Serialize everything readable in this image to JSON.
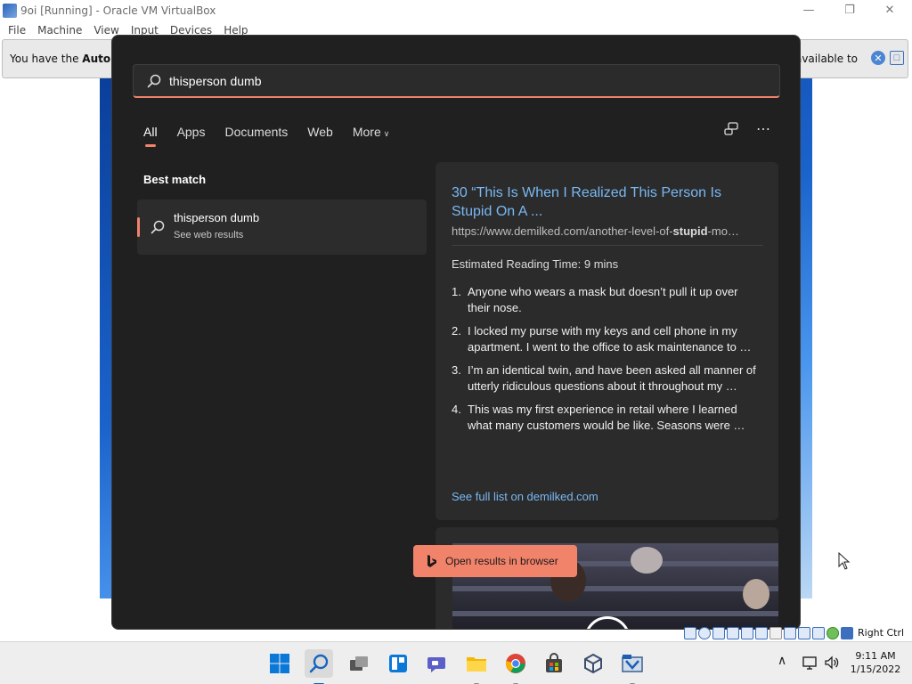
{
  "vbox": {
    "window_title": "9oi [Running] - Oracle VM VirtualBox",
    "menu": [
      "File",
      "Machine",
      "View",
      "Input",
      "Devices",
      "Help"
    ],
    "notification_prefix": "You have the",
    "notification_bold": "Auto cap",
    "notification_tail": "unavailable to",
    "host_key_label": "Right Ctrl"
  },
  "search": {
    "query": "thisperson dumb",
    "tabs": [
      {
        "label": "All",
        "active": true
      },
      {
        "label": "Apps"
      },
      {
        "label": "Documents"
      },
      {
        "label": "Web"
      },
      {
        "label": "More"
      }
    ],
    "best_match_heading": "Best match",
    "best_match": {
      "title": "thisperson dumb",
      "subtitle": "See web results"
    },
    "result": {
      "title": "30 “This Is When I Realized This Person Is Stupid On A ...",
      "url_prefix": "https://www.demilked.com/another-level-of-",
      "url_bold": "stupid",
      "url_suffix": "-mo…",
      "reading_time": "Estimated Reading Time: 9 mins",
      "items": [
        {
          "num": "1.",
          "text": "Anyone who wears a mask but doesn’t pull it up over their nose."
        },
        {
          "num": "2.",
          "text": "I locked my purse with my keys and cell phone in my apartment. I went to the office to ask maintenance to …"
        },
        {
          "num": "3.",
          "text": "I’m an identical twin, and have been asked all manner of utterly ridiculous questions about it throughout my …"
        },
        {
          "num": "4.",
          "text": "This was my first experience in retail where I learned what many customers would be like. Seasons were …"
        }
      ],
      "full_list_link": "See full list on demilked.com"
    },
    "open_browser_label": "Open results in browser"
  },
  "taskbar": {
    "time": "9:11 AM",
    "date": "1/15/2022",
    "apps": [
      "start-icon",
      "search-icon",
      "task-view-icon",
      "widgets-icon",
      "chat-icon",
      "file-explorer-icon",
      "chrome-icon",
      "store-icon",
      "virtualbox-guest-icon",
      "virtualbox-icon"
    ]
  },
  "colors": {
    "accent": "#f2836b",
    "link": "#79b8f3",
    "panel_bg": "#202020",
    "card_bg": "#2b2b2b"
  }
}
